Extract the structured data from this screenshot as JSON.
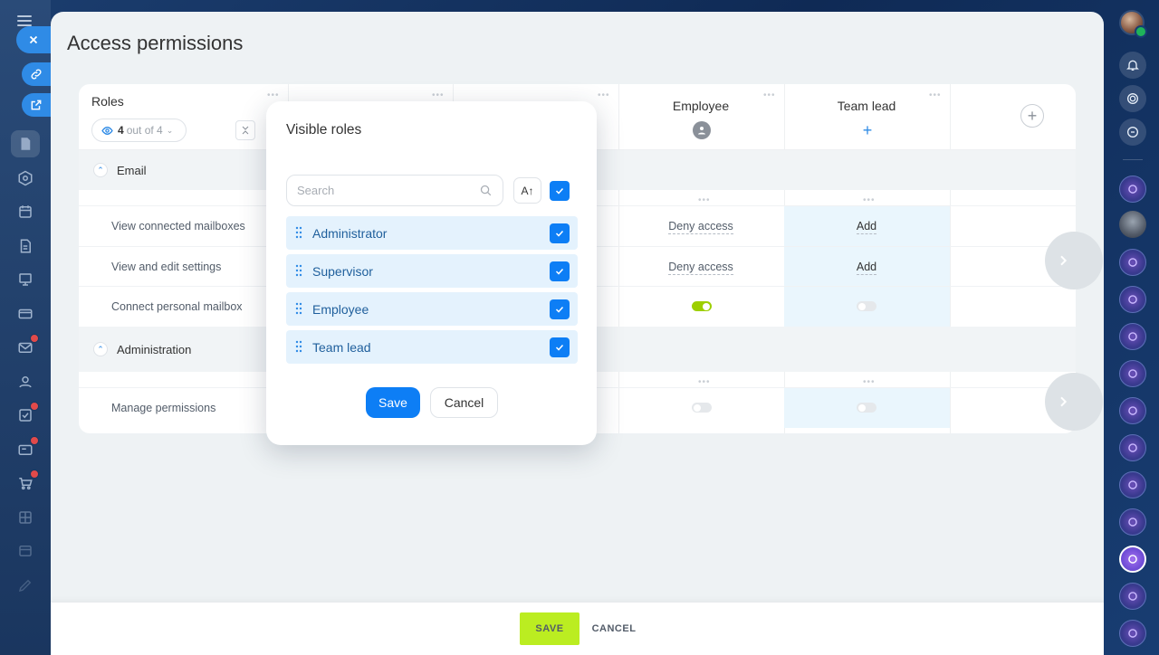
{
  "page": {
    "title": "Access permissions"
  },
  "table": {
    "roles_label": "Roles",
    "roles_count_value": "4",
    "roles_count_text": "out of 4",
    "columns": [
      {
        "name": "Employee",
        "icon": "user-icon"
      },
      {
        "name": "Team lead",
        "icon": "plus-icon"
      }
    ],
    "groups": [
      {
        "label": "Email",
        "rows": [
          {
            "label": "View connected mailboxes",
            "employee": "Deny access",
            "team_lead": "Add"
          },
          {
            "label": "View and edit settings",
            "employee": "Deny access",
            "team_lead": "Add"
          },
          {
            "label": "Connect personal mailbox",
            "employee_switch": true,
            "team_lead_switch": false
          }
        ]
      },
      {
        "label": "Administration",
        "rows": [
          {
            "label": "Manage permissions",
            "employee_switch": false,
            "team_lead_switch": false
          }
        ]
      }
    ]
  },
  "popup": {
    "title": "Visible roles",
    "search_placeholder": "Search",
    "sort_label": "A↑",
    "select_all_checked": true,
    "roles": [
      {
        "name": "Administrator",
        "checked": true
      },
      {
        "name": "Supervisor",
        "checked": true
      },
      {
        "name": "Employee",
        "checked": true
      },
      {
        "name": "Team lead",
        "checked": true
      }
    ],
    "save_label": "Save",
    "cancel_label": "Cancel"
  },
  "footer": {
    "save_label": "SAVE",
    "cancel_label": "CANCEL"
  },
  "colors": {
    "accent": "#0d7ef5",
    "save_green": "#bbed21",
    "switch_on": "#9dcf00"
  }
}
